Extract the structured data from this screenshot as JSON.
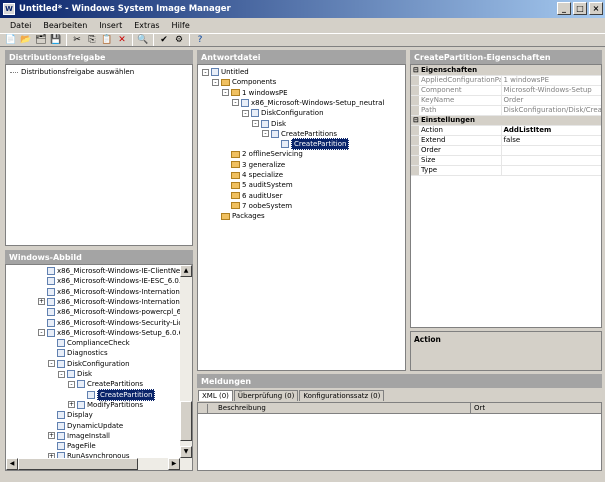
{
  "window": {
    "title": "Untitled* - Windows System Image Manager",
    "icon": "wsim-app-icon"
  },
  "menu": [
    "Datei",
    "Bearbeiten",
    "Insert",
    "Extras",
    "Hilfe"
  ],
  "toolbar": [
    "new-icon",
    "open-icon",
    "open-answer-icon",
    "save-icon",
    "cut-icon",
    "copy-icon",
    "paste-icon",
    "delete-icon",
    "find-icon",
    "validate-icon",
    "create-config-icon",
    "help-icon"
  ],
  "distribution": {
    "title": "Distributionsfreigabe",
    "item": "Distributionsfreigabe auswählen"
  },
  "windows_image": {
    "title": "Windows-Abbild",
    "items": [
      {
        "label": "x86_Microsoft-Windows-IE-ClientNetwork",
        "indent": 1,
        "exp": "",
        "icon": "doc"
      },
      {
        "label": "x86_Microsoft-Windows-IE-ESC_6.0.6001",
        "indent": 1,
        "exp": "",
        "icon": "doc"
      },
      {
        "label": "x86_Microsoft-Windows-International-Core",
        "indent": 1,
        "exp": "",
        "icon": "doc"
      },
      {
        "label": "x86_Microsoft-Windows-International-Core",
        "indent": 1,
        "exp": "+",
        "icon": "doc"
      },
      {
        "label": "x86_Microsoft-Windows-powercpl_6.0.600",
        "indent": 1,
        "exp": "",
        "icon": "doc"
      },
      {
        "label": "x86_Microsoft-Windows-Security-Licensin",
        "indent": 1,
        "exp": "",
        "icon": "doc"
      },
      {
        "label": "x86_Microsoft-Windows-Setup_6.0.6001.",
        "indent": 1,
        "exp": "-",
        "icon": "doc"
      },
      {
        "label": "ComplianceCheck",
        "indent": 2,
        "exp": "",
        "icon": "doc"
      },
      {
        "label": "Diagnostics",
        "indent": 2,
        "exp": "",
        "icon": "doc"
      },
      {
        "label": "DiskConfiguration",
        "indent": 2,
        "exp": "-",
        "icon": "doc"
      },
      {
        "label": "Disk",
        "indent": 3,
        "exp": "-",
        "icon": "doc"
      },
      {
        "label": "CreatePartitions",
        "indent": 4,
        "exp": "-",
        "icon": "doc"
      },
      {
        "label": "CreatePartition",
        "indent": 5,
        "exp": "",
        "icon": "doc",
        "selected": true
      },
      {
        "label": "ModifyPartitions",
        "indent": 4,
        "exp": "+",
        "icon": "doc"
      },
      {
        "label": "Display",
        "indent": 2,
        "exp": "",
        "icon": "doc"
      },
      {
        "label": "DynamicUpdate",
        "indent": 2,
        "exp": "",
        "icon": "doc"
      },
      {
        "label": "ImageInstall",
        "indent": 2,
        "exp": "+",
        "icon": "doc"
      },
      {
        "label": "PageFile",
        "indent": 2,
        "exp": "",
        "icon": "doc"
      },
      {
        "label": "RunAsynchronous",
        "indent": 2,
        "exp": "+",
        "icon": "doc"
      },
      {
        "label": "RunSynchronous",
        "indent": 2,
        "exp": "+",
        "icon": "doc"
      }
    ]
  },
  "answer_file": {
    "title": "Antwortdatei",
    "items": [
      {
        "label": "Untitled",
        "indent": 0,
        "exp": "-",
        "icon": "doc"
      },
      {
        "label": "Components",
        "indent": 1,
        "exp": "-",
        "icon": "fold"
      },
      {
        "label": "1 windowsPE",
        "indent": 2,
        "exp": "-",
        "icon": "num"
      },
      {
        "label": "x86_Microsoft-Windows-Setup_neutral",
        "indent": 3,
        "exp": "-",
        "icon": "doc"
      },
      {
        "label": "DiskConfiguration",
        "indent": 4,
        "exp": "-",
        "icon": "doc"
      },
      {
        "label": "Disk",
        "indent": 5,
        "exp": "-",
        "icon": "doc"
      },
      {
        "label": "CreatePartitions",
        "indent": 6,
        "exp": "-",
        "icon": "doc"
      },
      {
        "label": "CreatePartition",
        "indent": 7,
        "exp": "",
        "icon": "doc",
        "selected": true
      },
      {
        "label": "2 offlineServicing",
        "indent": 2,
        "exp": "",
        "icon": "num"
      },
      {
        "label": "3 generalize",
        "indent": 2,
        "exp": "",
        "icon": "num"
      },
      {
        "label": "4 specialize",
        "indent": 2,
        "exp": "",
        "icon": "num"
      },
      {
        "label": "5 auditSystem",
        "indent": 2,
        "exp": "",
        "icon": "num"
      },
      {
        "label": "6 auditUser",
        "indent": 2,
        "exp": "",
        "icon": "num"
      },
      {
        "label": "7 oobeSystem",
        "indent": 2,
        "exp": "",
        "icon": "num"
      },
      {
        "label": "Packages",
        "indent": 1,
        "exp": "",
        "icon": "fold"
      }
    ]
  },
  "properties": {
    "title": "CreatePartition-Eigenschaften",
    "sections": [
      {
        "name": "Eigenschaften",
        "rows": [
          [
            "AppliedConfigurationPass",
            "1 windowsPE"
          ],
          [
            "Component",
            "Microsoft-Windows-Setup"
          ],
          [
            "KeyName",
            "Order"
          ],
          [
            "Path",
            "DiskConfiguration/Disk/CreatePa"
          ]
        ],
        "readonly": true
      },
      {
        "name": "Einstellungen",
        "rows": [
          [
            "Action",
            "AddListItem"
          ],
          [
            "Extend",
            "false"
          ],
          [
            "Order",
            ""
          ],
          [
            "Size",
            ""
          ],
          [
            "Type",
            ""
          ]
        ],
        "readonly": false
      }
    ],
    "description_title": "Action"
  },
  "messages": {
    "title": "Meldungen",
    "tabs": [
      "XML (0)",
      "Überprüfung (0)",
      "Konfigurationssatz (0)"
    ],
    "columns": [
      "Beschreibung",
      "Ort"
    ]
  }
}
